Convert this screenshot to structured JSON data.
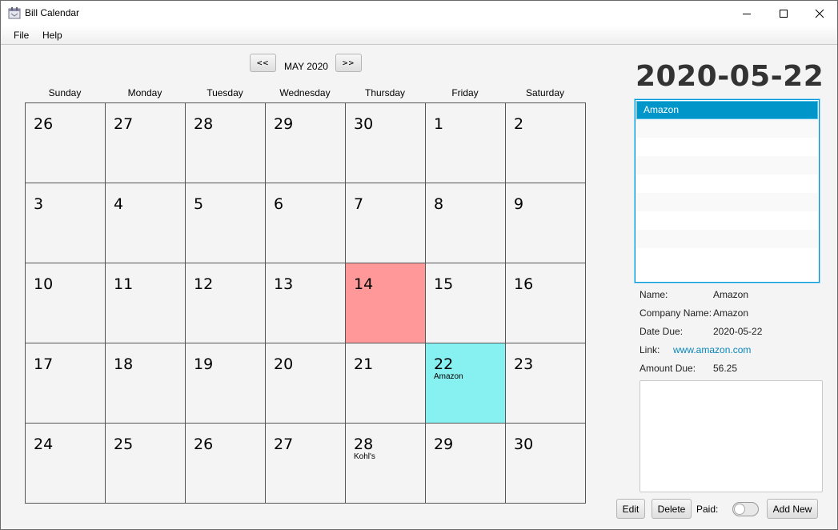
{
  "window": {
    "title": "Bill Calendar"
  },
  "menu": {
    "file": "File",
    "help": "Help"
  },
  "nav": {
    "prev": "<<",
    "next": ">>",
    "month": "MAY 2020"
  },
  "weekdays": [
    "Sunday",
    "Monday",
    "Tuesday",
    "Wednesday",
    "Thursday",
    "Friday",
    "Saturday"
  ],
  "days": [
    {
      "num": "26",
      "bill": ""
    },
    {
      "num": "27",
      "bill": ""
    },
    {
      "num": "28",
      "bill": ""
    },
    {
      "num": "29",
      "bill": ""
    },
    {
      "num": "30",
      "bill": ""
    },
    {
      "num": "1",
      "bill": ""
    },
    {
      "num": "2",
      "bill": ""
    },
    {
      "num": "3",
      "bill": ""
    },
    {
      "num": "4",
      "bill": ""
    },
    {
      "num": "5",
      "bill": ""
    },
    {
      "num": "6",
      "bill": ""
    },
    {
      "num": "7",
      "bill": ""
    },
    {
      "num": "8",
      "bill": ""
    },
    {
      "num": "9",
      "bill": ""
    },
    {
      "num": "10",
      "bill": ""
    },
    {
      "num": "11",
      "bill": ""
    },
    {
      "num": "12",
      "bill": ""
    },
    {
      "num": "13",
      "bill": ""
    },
    {
      "num": "14",
      "bill": "",
      "highlight": "red"
    },
    {
      "num": "15",
      "bill": ""
    },
    {
      "num": "16",
      "bill": ""
    },
    {
      "num": "17",
      "bill": ""
    },
    {
      "num": "18",
      "bill": ""
    },
    {
      "num": "19",
      "bill": ""
    },
    {
      "num": "20",
      "bill": ""
    },
    {
      "num": "21",
      "bill": ""
    },
    {
      "num": "22",
      "bill": "Amazon",
      "highlight": "cyan"
    },
    {
      "num": "23",
      "bill": ""
    },
    {
      "num": "24",
      "bill": ""
    },
    {
      "num": "25",
      "bill": ""
    },
    {
      "num": "26",
      "bill": ""
    },
    {
      "num": "27",
      "bill": ""
    },
    {
      "num": "28",
      "bill": "Kohl's"
    },
    {
      "num": "29",
      "bill": ""
    },
    {
      "num": "30",
      "bill": ""
    }
  ],
  "colors": {
    "highlight_red": "#ff9999",
    "highlight_cyan": "#87f0f0",
    "selection": "#0096c9",
    "link": "#0a86b8"
  },
  "detail": {
    "selected_date": "2020-05-22",
    "bills": [
      "Amazon",
      "",
      "",
      "",
      "",
      "",
      "",
      "",
      ""
    ],
    "name_label": "Name:",
    "name_value": "Amazon",
    "company_label": "Company Name:",
    "company_value": "Amazon",
    "due_label": "Date Due:",
    "due_value": "2020-05-22",
    "link_label": "Link:",
    "link_value": "www.amazon.com",
    "amount_label": "Amount Due:",
    "amount_value": "56.25",
    "notes": ""
  },
  "actions": {
    "edit": "Edit",
    "delete": "Delete",
    "paid": "Paid:",
    "add_new": "Add New",
    "paid_state": false
  }
}
